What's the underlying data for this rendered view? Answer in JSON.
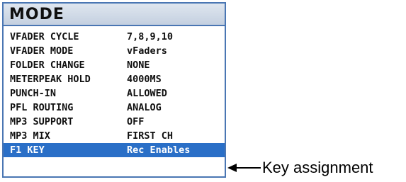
{
  "panel": {
    "title": "MODE",
    "rows": [
      {
        "key": "VFADER CYCLE",
        "value": "7,8,9,10"
      },
      {
        "key": "VFADER MODE",
        "value": "vFaders"
      },
      {
        "key": "FOLDER CHANGE",
        "value": "NONE"
      },
      {
        "key": "METERPEAK HOLD",
        "value": "4000MS"
      },
      {
        "key": "PUNCH-IN",
        "value": "ALLOWED"
      },
      {
        "key": "PFL ROUTING",
        "value": "ANALOG"
      },
      {
        "key": "MP3 SUPPORT",
        "value": "OFF"
      },
      {
        "key": "MP3 MIX",
        "value": "FIRST CH"
      },
      {
        "key": "F1 KEY",
        "value": "Rec Enables"
      }
    ],
    "selected_index": 8
  },
  "callout": {
    "text": "Key assignment",
    "icon": "arrow-left-icon"
  },
  "colors": {
    "border": "#4a76b3",
    "selection": "#2a6fc7"
  }
}
